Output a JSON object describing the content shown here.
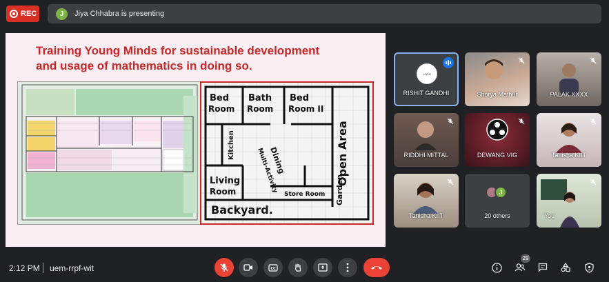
{
  "recording": {
    "label": "REC"
  },
  "presenter": {
    "avatar_letter": "J",
    "banner_text": "Jiya Chhabra is presenting"
  },
  "slide": {
    "title_line1": "Training Young Minds for sustainable development",
    "title_line2": "and usage of mathematics in doing so."
  },
  "participants": [
    {
      "name": "RISHIT GANDHI",
      "speaking": true
    },
    {
      "name": "Shorya Mathur",
      "muted": true
    },
    {
      "name": "PALAK XXXX",
      "muted": true
    },
    {
      "name": "RIDDHI MITTAL",
      "muted": true
    },
    {
      "name": "DEWANG VIG",
      "muted": true
    },
    {
      "name": "Tanisha KIIT",
      "muted": true
    },
    {
      "name": "Tanisha KIIT",
      "muted": true
    },
    {
      "name": "20 others",
      "avatar_letter": "J"
    },
    {
      "name": "You",
      "muted": true
    }
  ],
  "footer": {
    "time": "2:12 PM",
    "separator": "|",
    "meeting_code": "uem-rrpf-wit",
    "people_count": "29"
  },
  "colors": {
    "accent_red": "#ea4335",
    "speaking_blue": "#1a73e8",
    "background": "#202124"
  }
}
